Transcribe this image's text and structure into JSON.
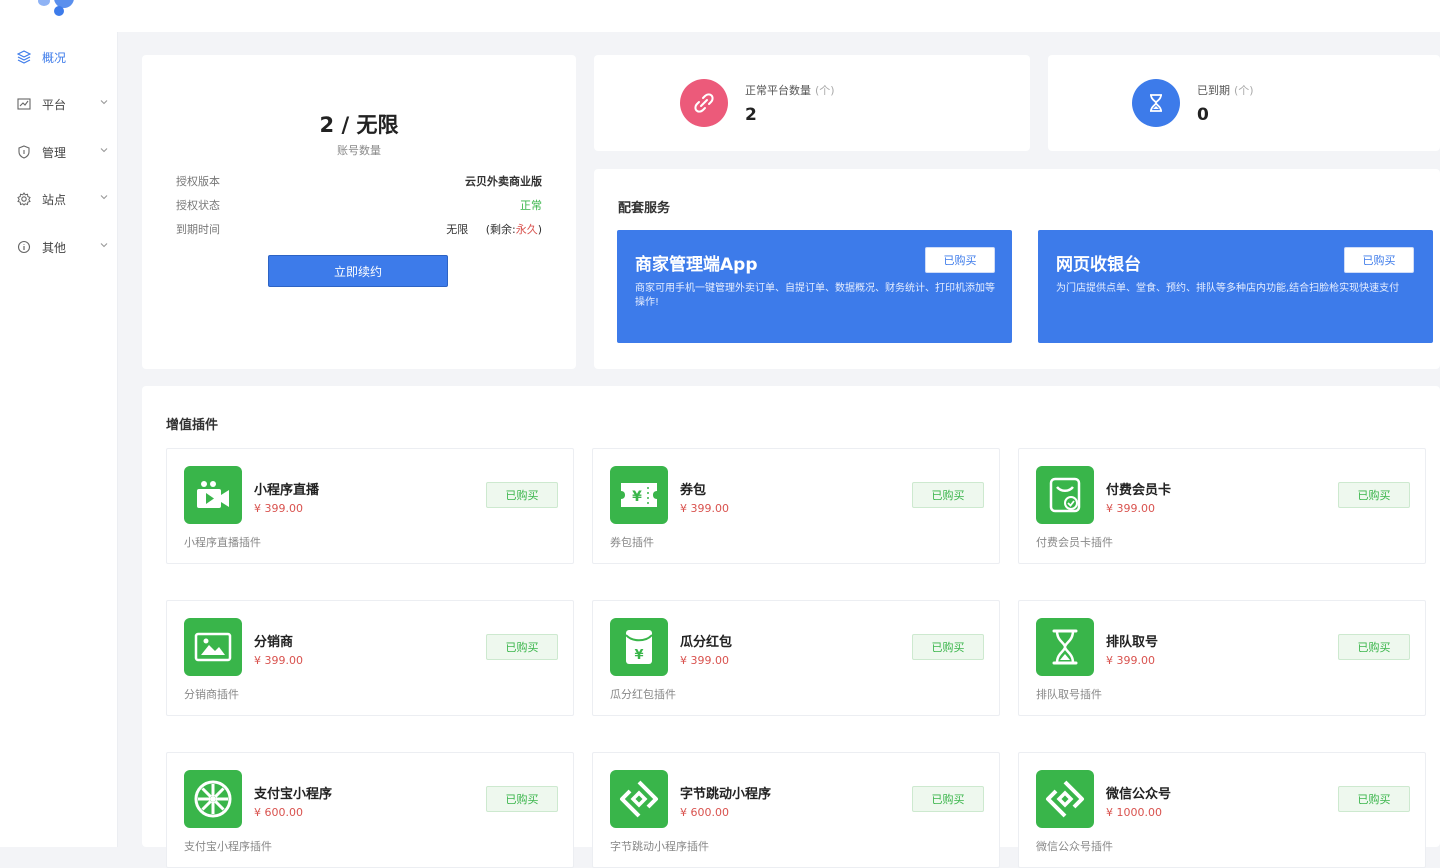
{
  "sidebar": {
    "items": [
      {
        "label": "概况",
        "icon": "layers-icon",
        "active": true
      },
      {
        "label": "平台",
        "icon": "chart-icon"
      },
      {
        "label": "管理",
        "icon": "shield-icon"
      },
      {
        "label": "站点",
        "icon": "gear-icon"
      },
      {
        "label": "其他",
        "icon": "info-icon"
      }
    ]
  },
  "account": {
    "count": "2 / 无限",
    "count_label": "账号数量",
    "version_label": "授权版本",
    "version_value": "云贝外卖商业版",
    "status_label": "授权状态",
    "status_value": "正常",
    "expire_label": "到期时间",
    "expire_value": "无限",
    "remain_prefix": "(剩余:",
    "remain_value": "永久",
    "remain_suffix": ")",
    "renew_button": "立即续约"
  },
  "stats": [
    {
      "label": "正常平台数量",
      "unit": "(个)",
      "value": "2",
      "color": "#ec5a7a"
    },
    {
      "label": "已到期",
      "unit": "(个)",
      "value": "0",
      "color": "#3d7bea"
    }
  ],
  "services": {
    "title": "配套服务",
    "items": [
      {
        "title": "商家管理端App",
        "badge": "已购买",
        "desc": "商家可用手机一键管理外卖订单、自提订单、数据概况、财务统计、打印机添加等操作!"
      },
      {
        "title": "网页收银台",
        "badge": "已购买",
        "desc": "为门店提供点单、堂食、预约、排队等多种店内功能,结合扫脸枪实现快速支付"
      }
    ]
  },
  "plugins": {
    "title": "增值插件",
    "items": [
      {
        "name": "小程序直播",
        "price": "¥ 399.00",
        "desc": "小程序直播插件",
        "badge": "已购买",
        "icon": "live-video-icon"
      },
      {
        "name": "券包",
        "price": "¥ 399.00",
        "desc": "券包插件",
        "badge": "已购买",
        "icon": "coupon-icon"
      },
      {
        "name": "付费会员卡",
        "price": "¥ 399.00",
        "desc": "付费会员卡插件",
        "badge": "已购买",
        "icon": "member-card-icon"
      },
      {
        "name": "分销商",
        "price": "¥ 399.00",
        "desc": "分销商插件",
        "badge": "已购买",
        "icon": "image-icon"
      },
      {
        "name": "瓜分红包",
        "price": "¥ 399.00",
        "desc": "瓜分红包插件",
        "badge": "已购买",
        "icon": "red-packet-icon"
      },
      {
        "name": "排队取号",
        "price": "¥ 399.00",
        "desc": "排队取号插件",
        "badge": "已购买",
        "icon": "hourglass-icon"
      },
      {
        "name": "支付宝小程序",
        "price": "¥ 600.00",
        "desc": "支付宝小程序插件",
        "badge": "已购买",
        "icon": "alipay-icon"
      },
      {
        "name": "字节跳动小程序",
        "price": "¥ 600.00",
        "desc": "字节跳动小程序插件",
        "badge": "已购买",
        "icon": "bytedance-icon"
      },
      {
        "name": "微信公众号",
        "price": "¥ 1000.00",
        "desc": "微信公众号插件",
        "badge": "已购买",
        "icon": "wechat-official-icon"
      }
    ]
  }
}
